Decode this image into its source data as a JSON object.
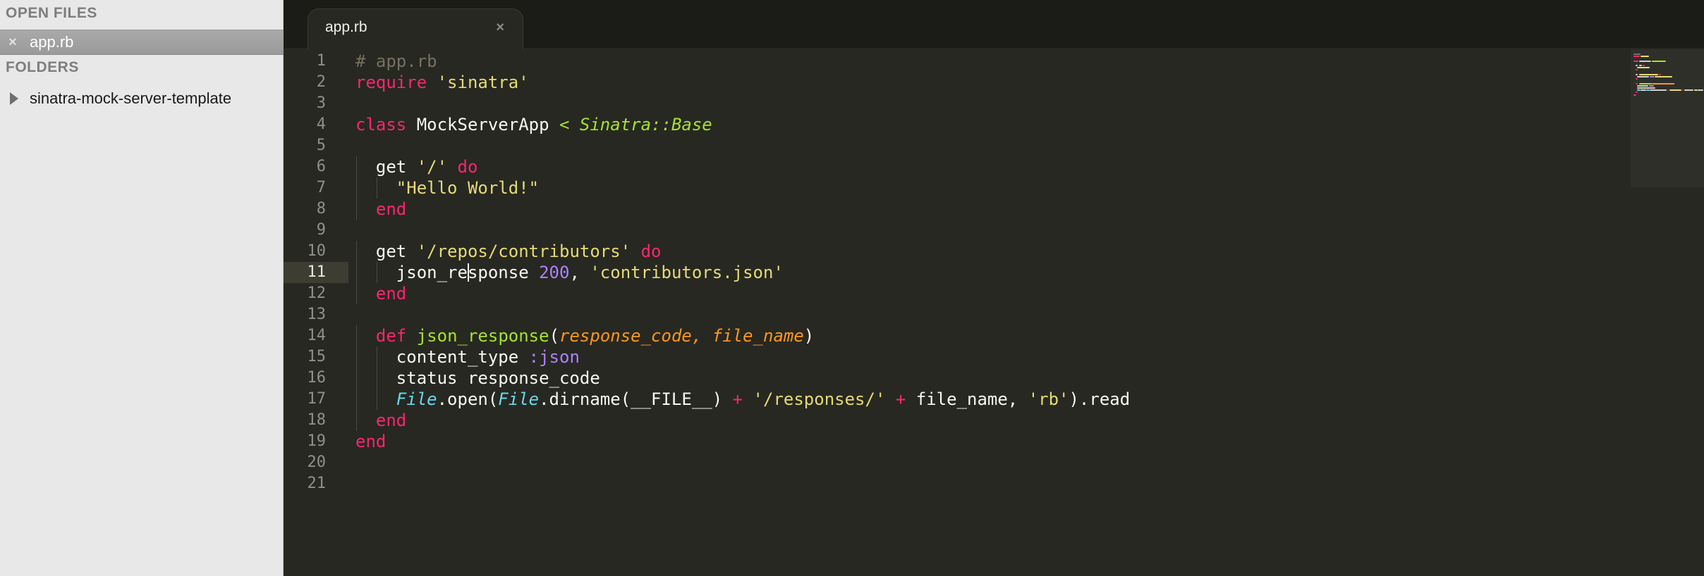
{
  "sidebar": {
    "open_files_heading": "OPEN FILES",
    "open_files": [
      {
        "close_glyph": "×",
        "label": "app.rb"
      }
    ],
    "folders_heading": "FOLDERS",
    "folders": [
      {
        "label": "sinatra-mock-server-template"
      }
    ]
  },
  "tabs": [
    {
      "label": "app.rb",
      "close_glyph": "×",
      "active": true
    }
  ],
  "editor": {
    "current_line": 11,
    "lines": [
      [
        {
          "t": "# app.rb",
          "c": "comment"
        }
      ],
      [
        {
          "t": "require",
          "c": "keyword"
        },
        {
          "t": " ",
          "c": "plain"
        },
        {
          "t": "'sinatra'",
          "c": "string"
        }
      ],
      [],
      [
        {
          "t": "class",
          "c": "keyword"
        },
        {
          "t": " MockServerApp ",
          "c": "class"
        },
        {
          "t": "< Sinatra::Base",
          "c": "inherit"
        }
      ],
      [],
      [
        {
          "t": "  get ",
          "c": "plain"
        },
        {
          "t": "'/'",
          "c": "string"
        },
        {
          "t": " ",
          "c": "plain"
        },
        {
          "t": "do",
          "c": "keyword"
        }
      ],
      [
        {
          "t": "    ",
          "c": "plain"
        },
        {
          "t": "\"Hello World!\"",
          "c": "string"
        }
      ],
      [
        {
          "t": "  ",
          "c": "plain"
        },
        {
          "t": "end",
          "c": "keyword"
        }
      ],
      [],
      [
        {
          "t": "  get ",
          "c": "plain"
        },
        {
          "t": "'/repos/contributors'",
          "c": "string"
        },
        {
          "t": " ",
          "c": "plain"
        },
        {
          "t": "do",
          "c": "keyword"
        }
      ],
      [
        {
          "t": "    json_response ",
          "c": "plain"
        },
        {
          "t": "200",
          "c": "number"
        },
        {
          "t": ", ",
          "c": "plain"
        },
        {
          "t": "'contributors.json'",
          "c": "string"
        }
      ],
      [
        {
          "t": "  ",
          "c": "plain"
        },
        {
          "t": "end",
          "c": "keyword"
        }
      ],
      [],
      [
        {
          "t": "  ",
          "c": "plain"
        },
        {
          "t": "def",
          "c": "keyword"
        },
        {
          "t": " ",
          "c": "plain"
        },
        {
          "t": "json_response",
          "c": "func"
        },
        {
          "t": "(",
          "c": "plain"
        },
        {
          "t": "response_code, file_name",
          "c": "param"
        },
        {
          "t": ")",
          "c": "plain"
        }
      ],
      [
        {
          "t": "    content_type ",
          "c": "plain"
        },
        {
          "t": ":json",
          "c": "symbol"
        }
      ],
      [
        {
          "t": "    status response_code",
          "c": "plain"
        }
      ],
      [
        {
          "t": "    ",
          "c": "plain"
        },
        {
          "t": "File",
          "c": "type"
        },
        {
          "t": ".open(",
          "c": "plain"
        },
        {
          "t": "File",
          "c": "type"
        },
        {
          "t": ".dirname(__FILE__) ",
          "c": "plain"
        },
        {
          "t": "+",
          "c": "op"
        },
        {
          "t": " ",
          "c": "plain"
        },
        {
          "t": "'/responses/'",
          "c": "string"
        },
        {
          "t": " ",
          "c": "plain"
        },
        {
          "t": "+",
          "c": "op"
        },
        {
          "t": " file_name, ",
          "c": "plain"
        },
        {
          "t": "'rb'",
          "c": "string"
        },
        {
          "t": ").read",
          "c": "plain"
        }
      ],
      [
        {
          "t": "  ",
          "c": "plain"
        },
        {
          "t": "end",
          "c": "keyword"
        }
      ],
      [
        {
          "t": "end",
          "c": "keyword"
        }
      ],
      [],
      []
    ]
  },
  "colors": {
    "editor_background": "#272822",
    "sidebar_background": "#e8e8e8",
    "keyword": "#f92672",
    "string": "#e6db74",
    "function": "#a6e22e",
    "parameter": "#fd971f",
    "number": "#ae81ff",
    "type": "#66d9ef",
    "comment": "#75715e"
  }
}
